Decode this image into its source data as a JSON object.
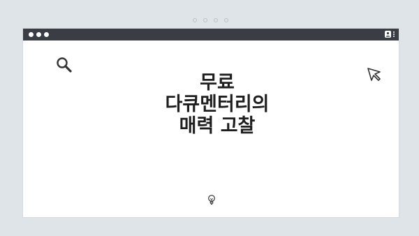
{
  "page": {
    "title_lines": [
      "무료",
      "다큐멘터리의",
      "매력 고찰"
    ]
  },
  "icons": {
    "search": "search-icon",
    "cursor": "cursor-arrow-icon",
    "bulb": "lightbulb-icon",
    "user": "user-icon",
    "menu": "kebab-menu-icon"
  },
  "colors": {
    "background": "#dfe4e9",
    "titlebar": "#3a3e44",
    "window": "#ffffff",
    "text": "#1e1e1e",
    "icon": "#333333"
  }
}
